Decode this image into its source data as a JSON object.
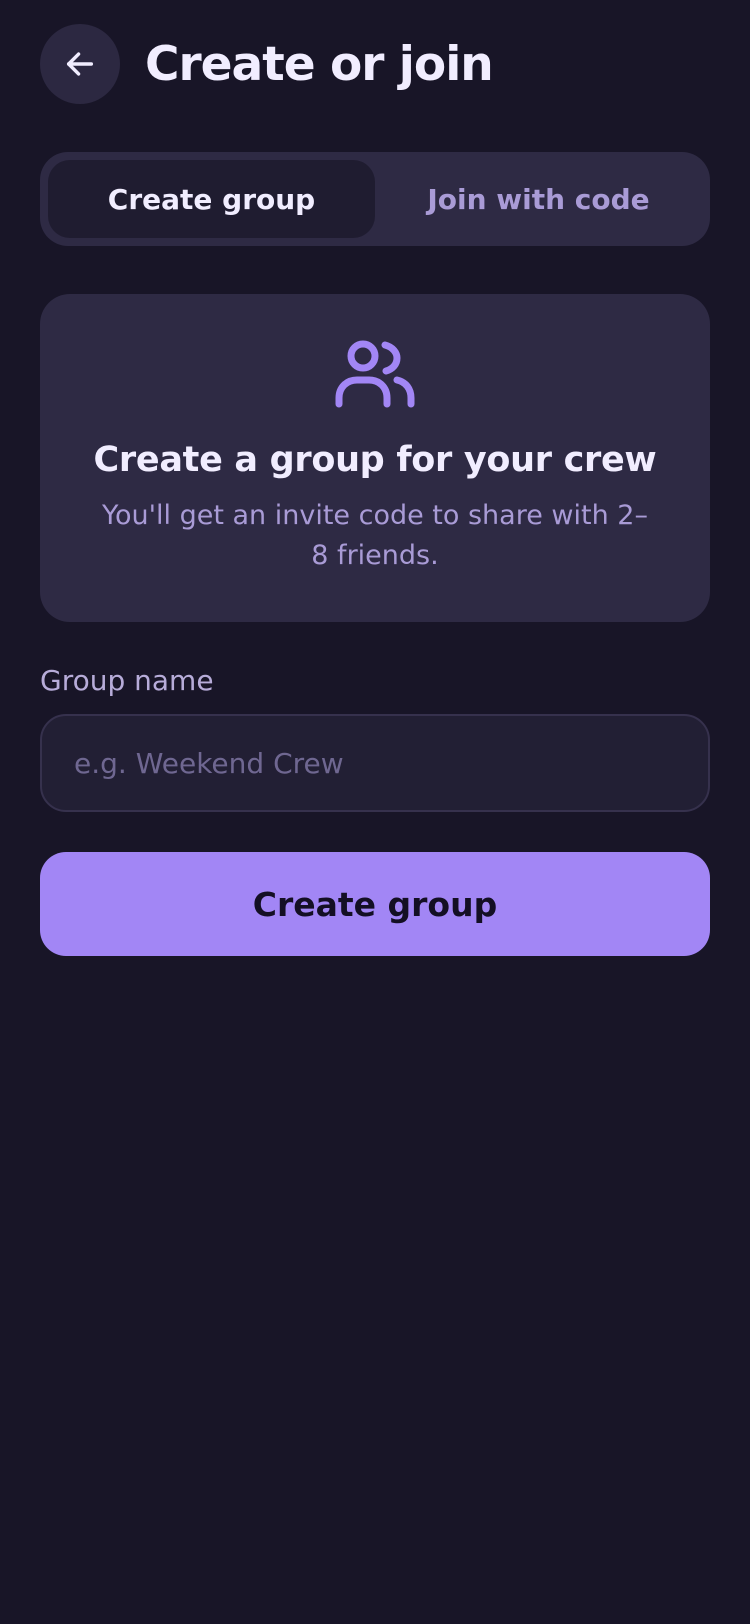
{
  "header": {
    "title": "Create or join",
    "back_icon": "arrow-left-icon"
  },
  "tabs": [
    {
      "label": "Create group",
      "active": true
    },
    {
      "label": "Join with code",
      "active": false
    }
  ],
  "card": {
    "icon": "users-icon",
    "title": "Create a group for your crew",
    "description": "You'll get an invite code to share with 2–8 friends."
  },
  "form": {
    "group_name_label": "Group name",
    "group_name_placeholder": "e.g. Weekend Crew",
    "group_name_value": ""
  },
  "primary_button": {
    "label": "Create group"
  },
  "colors": {
    "background": "#181527",
    "surface": "#2e2a44",
    "accent": "#a286f5",
    "text_primary": "#f1edff",
    "text_muted": "#a99bd6"
  }
}
